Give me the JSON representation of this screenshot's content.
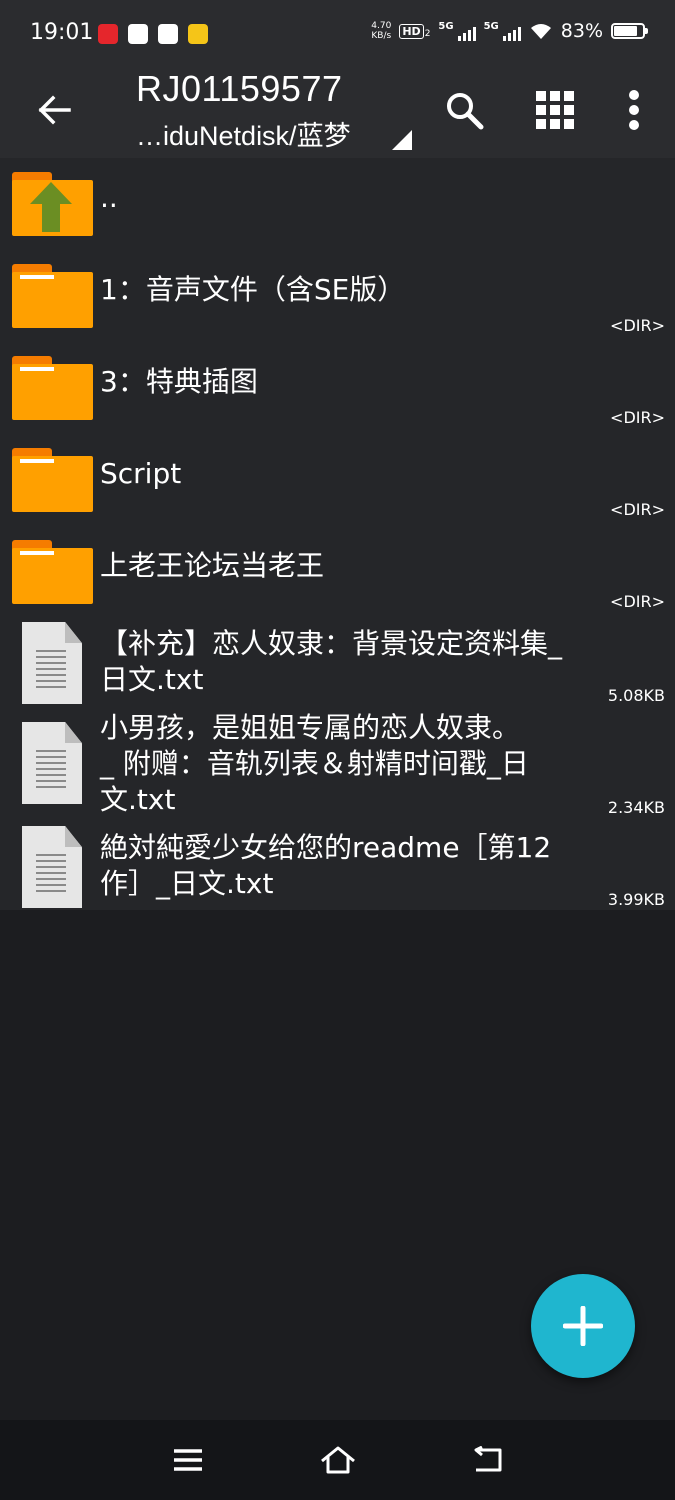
{
  "status_bar": {
    "time": "19:01",
    "speed_value": "4.70",
    "speed_unit": "KB/s",
    "hd_label": "HD",
    "hd_sub": "2",
    "network_1": "5G",
    "network_2": "5G",
    "battery_percent": "83%",
    "battery_level": 0.83
  },
  "toolbar": {
    "title": "RJ01159577",
    "path": "…iduNetdisk/蓝梦"
  },
  "entries": [
    {
      "name": "..",
      "type": "parent",
      "meta": ""
    },
    {
      "name": "1：音声文件（含SE版）",
      "type": "dir",
      "meta": "<DIR>"
    },
    {
      "name": "3：特典插图",
      "type": "dir",
      "meta": "<DIR>"
    },
    {
      "name": "Script",
      "type": "dir",
      "meta": "<DIR>"
    },
    {
      "name": "上老王论坛当老王",
      "type": "dir",
      "meta": "<DIR>"
    },
    {
      "name_lines": [
        "【补充】恋人奴隶：背景设定资料集_",
        "日文.txt"
      ],
      "type": "file",
      "meta": "5.08KB"
    },
    {
      "name_lines": [
        "小男孩，是姐姐专属的恋人奴隶。",
        "_ 附赠：音轨列表＆射精时间戳_日",
        "文.txt"
      ],
      "type": "file",
      "meta": "2.34KB"
    },
    {
      "name_lines": [
        "絶対純愛少女给您的readme［第12",
        "作］_日文.txt"
      ],
      "type": "file",
      "meta": "3.99KB"
    }
  ],
  "colors": {
    "background": "#1c1d20",
    "toolbar": "#2b2c2f",
    "row": "#252629",
    "folder": "#ffa000",
    "folder_tab": "#f57c00",
    "parent_arrow": "#6b8e23",
    "fab": "#1fb6cf"
  },
  "icons": {
    "back": "arrow-left-icon",
    "search": "search-icon",
    "view": "grid-view-icon",
    "more": "more-vertical-icon",
    "fab": "plus-icon",
    "nav_menu": "menu-icon",
    "nav_home": "home-icon",
    "nav_back": "return-icon"
  }
}
